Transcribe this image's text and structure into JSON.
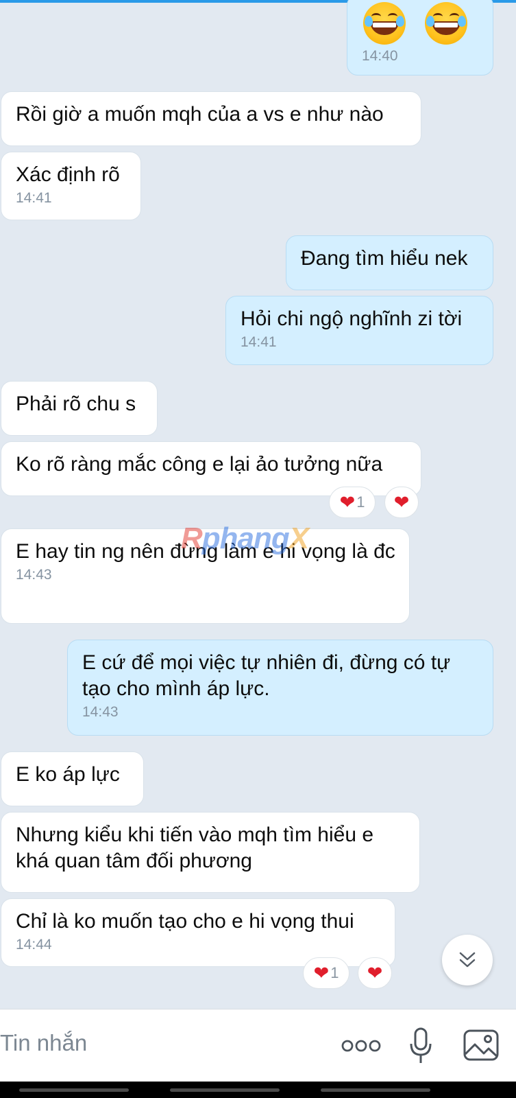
{
  "messages": [
    {
      "side": "out",
      "emoji": [
        "face-with-tears-of-joy",
        "face-with-tears-of-joy"
      ],
      "time": "14:40"
    },
    {
      "side": "in",
      "text": "Rồi giờ a muốn mqh của a vs e như nào"
    },
    {
      "side": "in",
      "text": "Xác định rõ",
      "time": "14:41"
    },
    {
      "side": "out",
      "text": "Đang tìm hiểu nek"
    },
    {
      "side": "out",
      "text": "Hỏi chi ngộ nghĩnh zi tời",
      "time": "14:41"
    },
    {
      "side": "in",
      "text": "Phải rõ chu s"
    },
    {
      "side": "in",
      "text": "Ko rõ ràng mắc công e lại ảo tưởng nữa",
      "reaction_count": "1"
    },
    {
      "side": "in",
      "text": "E hay tin ng nên đừng làm e hi vọng là đc",
      "time": "14:43"
    },
    {
      "side": "out",
      "text": "E cứ để mọi việc tự nhiên đi, đừng có tự tạo cho mình áp lực.",
      "time": "14:43"
    },
    {
      "side": "in",
      "text": "E ko áp lực"
    },
    {
      "side": "in",
      "text": "Nhưng kiểu khi tiến vào mqh tìm hiểu e khá quan tâm đối phương"
    },
    {
      "side": "in",
      "text": "Chỉ là ko muốn tạo cho e hi vọng thui",
      "time": "14:44",
      "reaction_count": "1"
    }
  ],
  "watermark": {
    "part1": "R",
    "part2": "phang",
    "part3": "X"
  },
  "composer": {
    "placeholder": "Tin nhắn"
  },
  "icons": {
    "more": "more-dots-icon",
    "mic": "microphone-icon",
    "image": "image-icon",
    "scroll": "double-chevron-down-icon",
    "heart": "heart-icon"
  },
  "colors": {
    "outgoing_bubble": "#d4efff",
    "incoming_bubble": "#ffffff",
    "background": "#e2e9f1",
    "heart": "#e01e2c"
  }
}
